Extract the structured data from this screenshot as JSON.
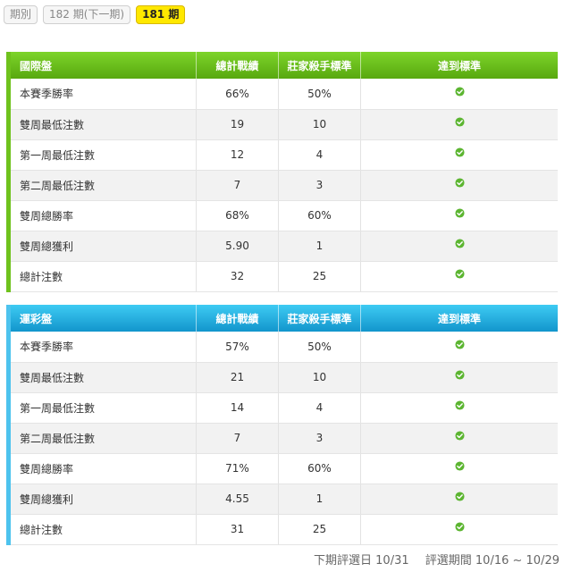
{
  "periods": {
    "label": "期別",
    "next": "182 期(下一期)",
    "current": "181 期"
  },
  "columns": {
    "total": "總計戰績",
    "standard": "莊家殺手標準",
    "reached": "達到標準"
  },
  "tables": [
    {
      "title": "國際盤",
      "rows": [
        {
          "label": "本賽季勝率",
          "total": "66%",
          "standard": "50%",
          "reached": true
        },
        {
          "label": "雙周最低注數",
          "total": "19",
          "standard": "10",
          "reached": true
        },
        {
          "label": "第一周最低注數",
          "total": "12",
          "standard": "4",
          "reached": true
        },
        {
          "label": "第二周最低注數",
          "total": "7",
          "standard": "3",
          "reached": true
        },
        {
          "label": "雙周總勝率",
          "total": "68%",
          "standard": "60%",
          "reached": true
        },
        {
          "label": "雙周總獲利",
          "total": "5.90",
          "standard": "1",
          "reached": true
        },
        {
          "label": "總計注數",
          "total": "32",
          "standard": "25",
          "reached": true
        }
      ]
    },
    {
      "title": "運彩盤",
      "rows": [
        {
          "label": "本賽季勝率",
          "total": "57%",
          "standard": "50%",
          "reached": true
        },
        {
          "label": "雙周最低注數",
          "total": "21",
          "standard": "10",
          "reached": true
        },
        {
          "label": "第一周最低注數",
          "total": "14",
          "standard": "4",
          "reached": true
        },
        {
          "label": "第二周最低注數",
          "total": "7",
          "standard": "3",
          "reached": true
        },
        {
          "label": "雙周總勝率",
          "total": "71%",
          "standard": "60%",
          "reached": true
        },
        {
          "label": "雙周總獲利",
          "total": "4.55",
          "standard": "1",
          "reached": true
        },
        {
          "label": "總計注數",
          "total": "31",
          "standard": "25",
          "reached": true
        }
      ]
    }
  ],
  "footer": {
    "next_review": "下期評選日 10/31",
    "review_period": "評選期間 10/16 ~ 10/29"
  },
  "colors": {
    "intl_header": "#6fc21d",
    "lottery_header": "#1fa6dd",
    "check": "#5cb531",
    "current_period": "#ffe800"
  },
  "icons": {
    "reached": "check-circle-icon"
  }
}
